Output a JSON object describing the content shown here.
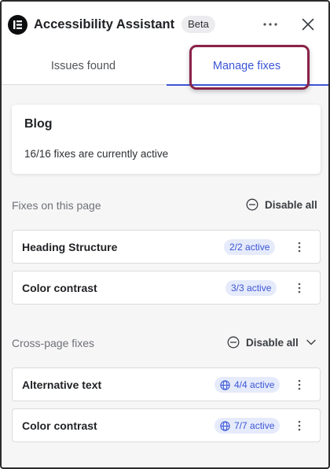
{
  "header": {
    "title": "Accessibility Assistant",
    "badge": "Beta",
    "icons": {
      "logo": "elementor-logo-icon",
      "more": "more-horizontal-icon",
      "close": "close-icon"
    }
  },
  "tabs": [
    {
      "label": "Issues found",
      "active": false
    },
    {
      "label": "Manage fixes",
      "active": true
    }
  ],
  "page_card": {
    "name": "Blog",
    "summary": "16/16 fixes are currently active"
  },
  "sections": {
    "on_page": {
      "title": "Fixes on this page",
      "action": "Disable all",
      "action_icon": "minus-circle-icon",
      "items": [
        {
          "label": "Heading Structure",
          "status": "2/2 active"
        },
        {
          "label": "Color contrast",
          "status": "3/3 active"
        }
      ]
    },
    "cross_page": {
      "title": "Cross-page fixes",
      "action": "Disable all",
      "action_icon": "minus-circle-icon",
      "expand_icon": "chevron-down-icon",
      "items": [
        {
          "label": "Alternative text",
          "status": "4/4 active",
          "icon": "globe-icon"
        },
        {
          "label": "Color contrast",
          "status": "7/7 active",
          "icon": "globe-icon"
        }
      ]
    }
  },
  "colors": {
    "accent": "#3b55d6",
    "badge_bg": "#e6ebfb",
    "annotation": "#8a2248"
  }
}
